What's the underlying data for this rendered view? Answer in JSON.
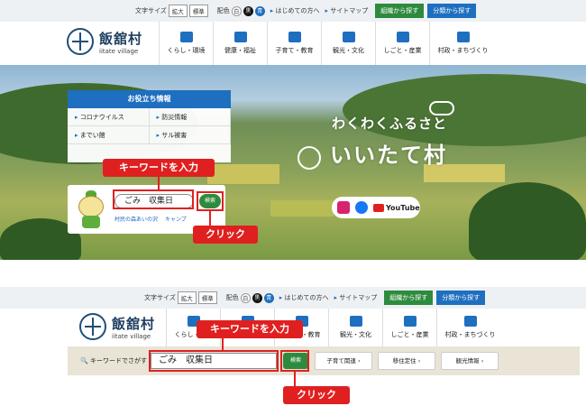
{
  "utility": {
    "font_size_label": "文字サイズ",
    "enlarge": "拡大",
    "standard": "標準",
    "color_label": "配色",
    "white": "白",
    "black": "黒",
    "blue": "青",
    "first_time": "はじめての方へ",
    "sitemap": "サイトマップ",
    "by_org": "組織から探す",
    "by_category": "分類から探す"
  },
  "logo": {
    "jp": "飯舘村",
    "en": "iitate village"
  },
  "nav": [
    "くらし・環境",
    "健康・福祉",
    "子育て・教育",
    "観光・文化",
    "しごと・産業",
    "村政・まちづくり"
  ],
  "hero": {
    "slogan_small": "わくわくふるさと",
    "slogan_big": "いいたて村",
    "youtube": "YouTube"
  },
  "helpful": {
    "title": "お役立ち情報",
    "items": [
      "コロナウイルス",
      "防災情報",
      "までい館",
      "サル被害"
    ]
  },
  "search": {
    "value": "ごみ　収集日",
    "button": "検索",
    "links": [
      "村民の森あいの沢",
      "キャンプ"
    ]
  },
  "annotations": {
    "enter_keyword": "キーワードを入力",
    "click": "クリック"
  },
  "sub_search": {
    "label": "キーワードでさがす",
    "value": "ごみ　収集日",
    "button": "検索",
    "pills": [
      "子育て関連",
      "移住定住",
      "観光情報"
    ]
  },
  "colors": {
    "accent_blue": "#1e6fbf",
    "accent_green": "#2e8b3e",
    "highlight_red": "#e02020"
  }
}
